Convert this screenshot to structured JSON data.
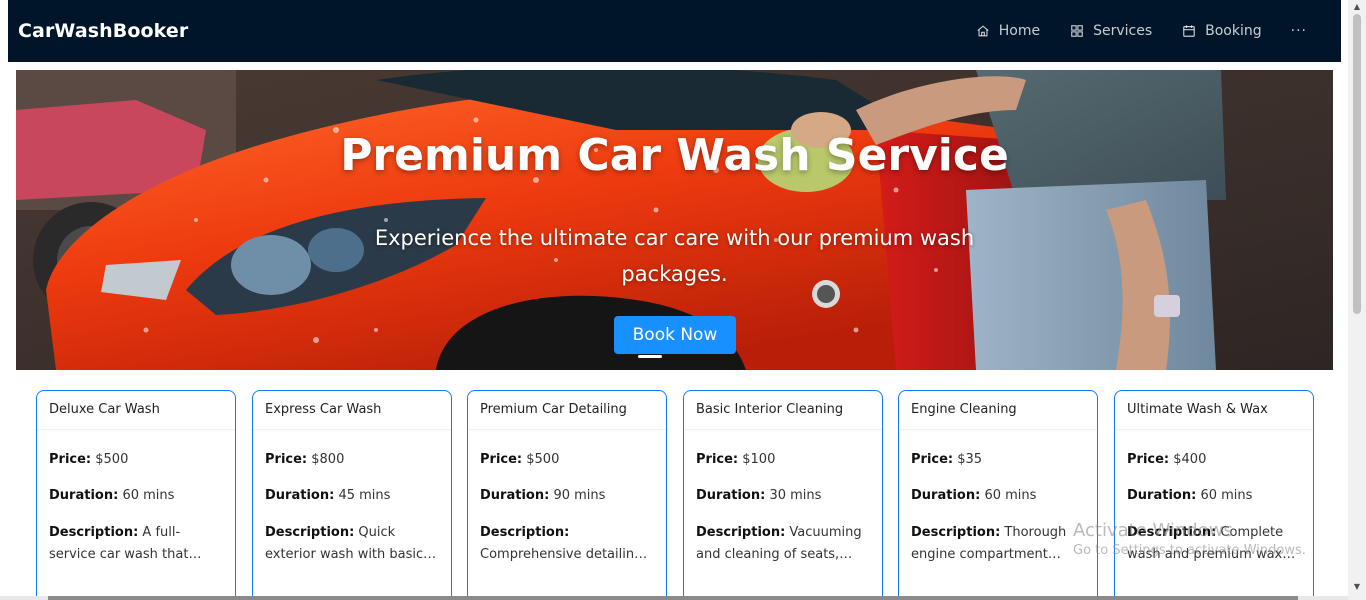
{
  "header": {
    "brand": "CarWashBooker",
    "nav": [
      {
        "label": "Home",
        "icon": "home-icon"
      },
      {
        "label": "Services",
        "icon": "grid-icon"
      },
      {
        "label": "Booking",
        "icon": "calendar-icon"
      }
    ],
    "more": "···"
  },
  "hero": {
    "title": "Premium Car Wash Service",
    "subtitle": "Experience the ultimate car care with our premium wash packages.",
    "cta": "Book Now"
  },
  "labels": {
    "price": "Price:",
    "duration": "Duration:",
    "description": "Description:"
  },
  "services": [
    {
      "name": "Deluxe Car Wash",
      "price": "$500",
      "duration": "60 mins",
      "description": "A full-service car wash that includes exterior and interior cleaning."
    },
    {
      "name": "Express Car Wash",
      "price": "$800",
      "duration": "45 mins",
      "description": "Quick exterior wash with basic cleaning, ideal for a fast refresh."
    },
    {
      "name": "Premium Car Detailing",
      "price": "$500",
      "duration": "90 mins",
      "description": "Comprehensive detailing for interior and exterior surfaces."
    },
    {
      "name": "Basic Interior Cleaning",
      "price": "$100",
      "duration": "30 mins",
      "description": "Vacuuming and cleaning of seats, floors and dashboard."
    },
    {
      "name": "Engine Cleaning",
      "price": "$35",
      "duration": "60 mins",
      "description": "Thorough engine compartment cleaning and degreasing."
    },
    {
      "name": "Ultimate Wash & Wax",
      "price": "$400",
      "duration": "60 mins",
      "description": "Complete wash and premium wax finish for lasting shine."
    }
  ],
  "watermark": {
    "line1": "Activate Windows",
    "line2": "Go to Settings to activate Windows."
  },
  "colors": {
    "header_bg": "#001529",
    "accent": "#1890ff",
    "card_border": "#1677ff"
  }
}
